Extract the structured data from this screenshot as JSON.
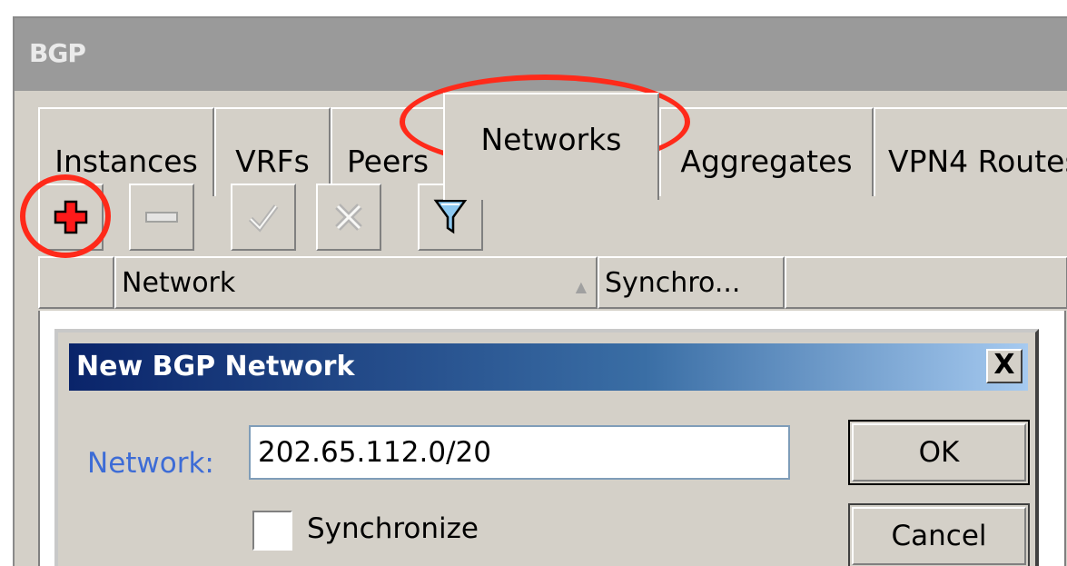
{
  "window": {
    "title": "BGP"
  },
  "tabs": [
    {
      "label": "Instances"
    },
    {
      "label": "VRFs"
    },
    {
      "label": "Peers"
    },
    {
      "label": "Networks",
      "active": true
    },
    {
      "label": "Aggregates"
    },
    {
      "label": "VPN4 Routes"
    }
  ],
  "toolbar": {
    "buttons": [
      {
        "icon": "plus-icon",
        "state": "enabled"
      },
      {
        "icon": "minus-icon",
        "state": "disabled"
      },
      {
        "icon": "check-icon",
        "state": "disabled"
      },
      {
        "icon": "cross-icon",
        "state": "disabled"
      },
      {
        "icon": "filter-icon",
        "state": "enabled"
      }
    ]
  },
  "table": {
    "columns": [
      {
        "label": ""
      },
      {
        "label": "Network",
        "sort": "ascending"
      },
      {
        "label": "Synchro..."
      },
      {
        "label": ""
      }
    ]
  },
  "dialog": {
    "title": "New BGP Network",
    "close_label": "X",
    "network_label": "Network:",
    "network_value": "202.65.112.0/20",
    "synchronize_label": "Synchronize",
    "synchronize_checked": false,
    "ok_label": "OK",
    "cancel_label": "Cancel"
  },
  "annotations": {
    "color": "#ff2a1a",
    "items": [
      "tab-networks",
      "add-button"
    ]
  },
  "colors": {
    "window_bg": "#d4d0c8",
    "titlebar_bg": "#9a9a9a",
    "dialog_title_start": "#0a246a",
    "dialog_title_end": "#a6caf0",
    "label_blue": "#3d6cd6"
  }
}
